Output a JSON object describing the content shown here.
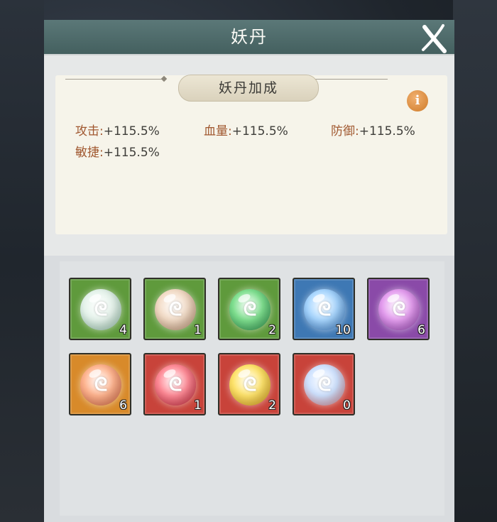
{
  "panel": {
    "title": "妖丹",
    "bonus_header": "妖丹加成",
    "info_icon": "info-icon",
    "info_glyph": "i",
    "close_icon": "close-icon"
  },
  "stats": [
    {
      "label": "攻击:",
      "value": "+115.5%"
    },
    {
      "label": "血量:",
      "value": "+115.5%"
    },
    {
      "label": "防御:",
      "value": "+115.5%"
    },
    {
      "label": "敏捷:",
      "value": "+115.5%"
    }
  ],
  "orb_glyph": "ᘓ",
  "items": [
    {
      "count": "4",
      "tile": "#5f9a3c",
      "orb": "#e6f4ec",
      "orb_edge": "#9fd0b7"
    },
    {
      "count": "1",
      "tile": "#5f9a3c",
      "orb": "#f3dcc7",
      "orb_edge": "#c79c7a"
    },
    {
      "count": "2",
      "tile": "#5f9a3c",
      "orb": "#7fe08f",
      "orb_edge": "#2f9a52"
    },
    {
      "count": "10",
      "tile": "#3e78b4",
      "orb": "#a7d6ff",
      "orb_edge": "#3f86d6"
    },
    {
      "count": "6",
      "tile": "#8a4aa8",
      "orb": "#e59ef0",
      "orb_edge": "#a04bc0"
    },
    {
      "count": "6",
      "tile": "#d88a2a",
      "orb": "#ffb48f",
      "orb_edge": "#e56e48"
    },
    {
      "count": "1",
      "tile": "#c8433a",
      "orb": "#ff8a96",
      "orb_edge": "#d2283c"
    },
    {
      "count": "2",
      "tile": "#c8433a",
      "orb": "#ffe46b",
      "orb_edge": "#e5a81c"
    },
    {
      "count": "0",
      "tile": "#c8433a",
      "orb": "#cfe2ff",
      "orb_edge": "#e98a90"
    }
  ]
}
